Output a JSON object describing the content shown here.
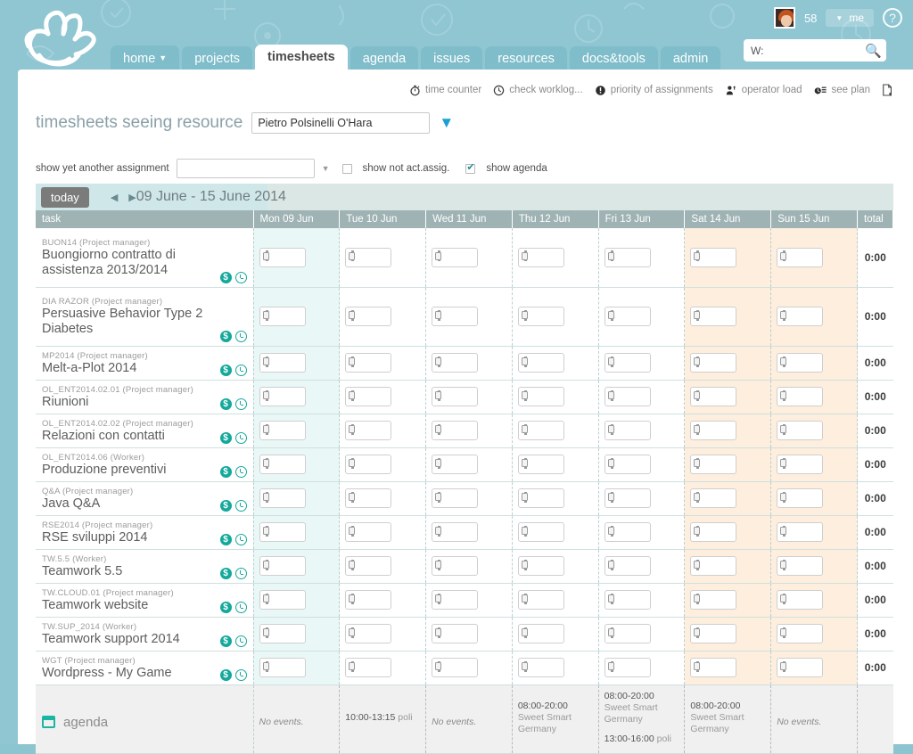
{
  "header": {
    "logo_name": "teamwork-hand-logo",
    "tabs": [
      {
        "label": "home",
        "has_caret": true,
        "active": false
      },
      {
        "label": "projects",
        "has_caret": false,
        "active": false
      },
      {
        "label": "timesheets",
        "has_caret": false,
        "active": true
      },
      {
        "label": "agenda",
        "has_caret": false,
        "active": false
      },
      {
        "label": "issues",
        "has_caret": false,
        "active": false
      },
      {
        "label": "resources",
        "has_caret": false,
        "active": false
      },
      {
        "label": "docs&tools",
        "has_caret": false,
        "active": false
      },
      {
        "label": "admin",
        "has_caret": false,
        "active": false
      }
    ],
    "notification_count": "58",
    "me_label": "me",
    "help_label": "?",
    "search_value": "W:",
    "search_placeholder": "W:"
  },
  "action_bar": [
    {
      "label": "time counter",
      "icon": "stopwatch-icon"
    },
    {
      "label": "check worklog...",
      "icon": "clock-icon"
    },
    {
      "label": "priority of assignments",
      "icon": "exclamation-icon"
    },
    {
      "label": "operator load",
      "icon": "person-load-icon"
    },
    {
      "label": "see plan",
      "icon": "plan-icon"
    },
    {
      "label": "",
      "icon": "export-document-icon"
    }
  ],
  "resource": {
    "label": "timesheets seeing resource",
    "selected": "Pietro Polsinelli O'Hara",
    "placeholder": ""
  },
  "filters": {
    "assignment_label": "show yet another assignment",
    "assignment_value": "",
    "assignment_placeholder": "",
    "show_not_act_label": "show not act.assig.",
    "show_not_act_checked": false,
    "show_agenda_label": "show agenda",
    "show_agenda_checked": true
  },
  "date_bar": {
    "today_label": "today",
    "prev_label": "◀",
    "next_label": "▶",
    "range": "09 June - 15 June 2014"
  },
  "grid": {
    "task_header": "task",
    "total_header": "total",
    "days": [
      {
        "label": "Mon 09 Jun",
        "today": true,
        "weekend": false
      },
      {
        "label": "Tue 10 Jun",
        "today": false,
        "weekend": false
      },
      {
        "label": "Wed 11 Jun",
        "today": false,
        "weekend": false
      },
      {
        "label": "Thu 12 Jun",
        "today": false,
        "weekend": false
      },
      {
        "label": "Fri 13 Jun",
        "today": false,
        "weekend": false
      },
      {
        "label": "Sat 14 Jun",
        "today": false,
        "weekend": true
      },
      {
        "label": "Sun 15 Jun",
        "today": false,
        "weekend": true
      }
    ],
    "rows": [
      {
        "code": "BUON14 (Project manager)",
        "name": "Buongiorno contratto di assistenza 2013/2014",
        "values": [
          "",
          "",
          "",
          "",
          "",
          "",
          ""
        ],
        "total": "0:00",
        "tall": true
      },
      {
        "code": "DIA RAZOR (Project manager)",
        "name": "Persuasive Behavior Type 2 Diabetes",
        "values": [
          "",
          "",
          "",
          "",
          "",
          "",
          ""
        ],
        "total": "0:00",
        "tall": true
      },
      {
        "code": "MP2014 (Project manager)",
        "name": "Melt-a-Plot 2014",
        "values": [
          "",
          "",
          "",
          "",
          "",
          "",
          ""
        ],
        "total": "0:00",
        "tall": false
      },
      {
        "code": "OL_ENT2014.02.01 (Project manager)",
        "name": "Riunioni",
        "values": [
          "",
          "",
          "",
          "",
          "",
          "",
          ""
        ],
        "total": "0:00",
        "tall": false
      },
      {
        "code": "OL_ENT2014.02.02 (Project manager)",
        "name": "Relazioni con contatti",
        "values": [
          "",
          "",
          "",
          "",
          "",
          "",
          ""
        ],
        "total": "0:00",
        "tall": false
      },
      {
        "code": "OL_ENT2014.06 (Worker)",
        "name": "Produzione preventivi",
        "values": [
          "",
          "",
          "",
          "",
          "",
          "",
          ""
        ],
        "total": "0:00",
        "tall": false
      },
      {
        "code": "Q&A (Project manager)",
        "name": "Java Q&A",
        "values": [
          "",
          "",
          "",
          "",
          "",
          "",
          ""
        ],
        "total": "0:00",
        "tall": false
      },
      {
        "code": "RSE2014 (Project manager)",
        "name": "RSE sviluppi 2014",
        "values": [
          "",
          "",
          "",
          "",
          "",
          "",
          ""
        ],
        "total": "0:00",
        "tall": false
      },
      {
        "code": "TW.5.5 (Worker)",
        "name": "Teamwork 5.5",
        "values": [
          "",
          "",
          "",
          "",
          "",
          "",
          ""
        ],
        "total": "0:00",
        "tall": false
      },
      {
        "code": "TW.CLOUD.01 (Project manager)",
        "name": "Teamwork website",
        "values": [
          "",
          "",
          "",
          "",
          "",
          "",
          ""
        ],
        "total": "0:00",
        "tall": false
      },
      {
        "code": "TW.SUP_2014 (Worker)",
        "name": "Teamwork support 2014",
        "values": [
          "",
          "",
          "",
          "",
          "",
          "",
          ""
        ],
        "total": "0:00",
        "tall": false
      },
      {
        "code": "WGT (Project manager)",
        "name": "Wordpress - My Game",
        "values": [
          "",
          "",
          "",
          "",
          "",
          "",
          ""
        ],
        "total": "0:00",
        "tall": false
      }
    ],
    "agenda": {
      "label": "agenda",
      "days": [
        {
          "empty_text": "No events.",
          "events": []
        },
        {
          "empty_text": "",
          "events": [
            {
              "time": "10:00-13:15",
              "title": "poli"
            }
          ]
        },
        {
          "empty_text": "No events.",
          "events": []
        },
        {
          "empty_text": "",
          "events": [
            {
              "time": "08:00-20:00",
              "title": "Sweet Smart Germany"
            }
          ]
        },
        {
          "empty_text": "",
          "events": [
            {
              "time": "08:00-20:00",
              "title": "Sweet Smart Germany"
            },
            {
              "time": "13:00-16:00",
              "title": "poli"
            }
          ]
        },
        {
          "empty_text": "",
          "events": [
            {
              "time": "08:00-20:00",
              "title": "Sweet Smart Germany"
            }
          ]
        },
        {
          "empty_text": "No events.",
          "events": []
        }
      ]
    }
  },
  "colors": {
    "brand_teal": "#8fc6d2",
    "accent_green": "#13a89e",
    "today_col": "#e9f8f6",
    "weekend_col": "#fdeedd",
    "header_gray": "#9fb3b4"
  }
}
